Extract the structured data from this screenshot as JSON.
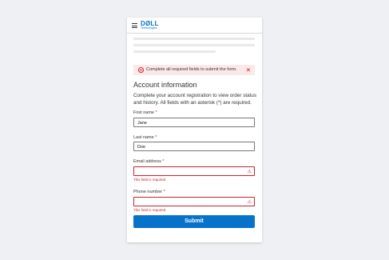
{
  "header": {
    "brand": "DØLL",
    "brand_sub": "Technologies",
    "menu_icon": "hamburger-icon"
  },
  "alert": {
    "icon": "error-circle-icon",
    "message": "Complete all required fields to submit the form.",
    "close_label": "✕"
  },
  "form": {
    "title": "Account information",
    "description": "Complete your account registration to view order status and history. All fields with an asterisk (*) are required.",
    "required_marker": "*",
    "fields": [
      {
        "label": "First name",
        "value": "Jane"
      },
      {
        "label": "Last name",
        "value": "Doe"
      },
      {
        "label": "Email address",
        "value": "",
        "error": "This field is required"
      },
      {
        "label": "Phone number",
        "value": "",
        "error": "This field is required"
      }
    ],
    "warning_icon": "⚠",
    "submit_label": "Submit"
  },
  "colors": {
    "accent": "#0672cb",
    "error": "#c9202d",
    "alert_bg": "#fbe9ea",
    "page_bg": "#eef0f3"
  }
}
